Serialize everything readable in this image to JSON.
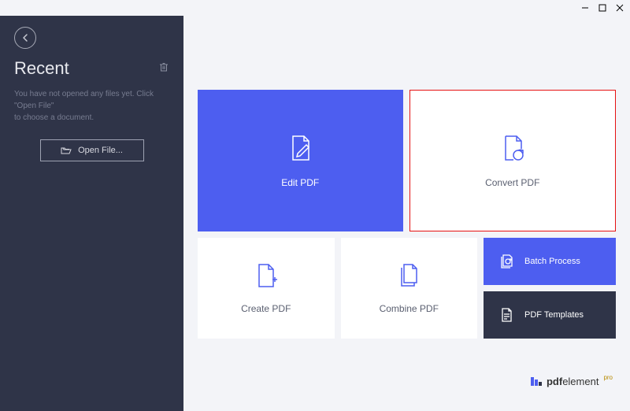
{
  "window": {
    "controls": {
      "minimize": "_",
      "maximize": "▢",
      "close": "✕"
    }
  },
  "sidebar": {
    "recent_title": "Recent",
    "hint_line1": "You have not opened any files yet. Click \"Open File\"",
    "hint_line2": "to choose a document.",
    "open_file_label": "Open File..."
  },
  "tiles": {
    "edit": "Edit PDF",
    "convert": "Convert PDF",
    "create": "Create PDF",
    "combine": "Combine PDF",
    "batch": "Batch Process",
    "templates": "PDF Templates"
  },
  "brand": {
    "prefix": "pdf",
    "suffix": "element",
    "tag": "pro"
  }
}
